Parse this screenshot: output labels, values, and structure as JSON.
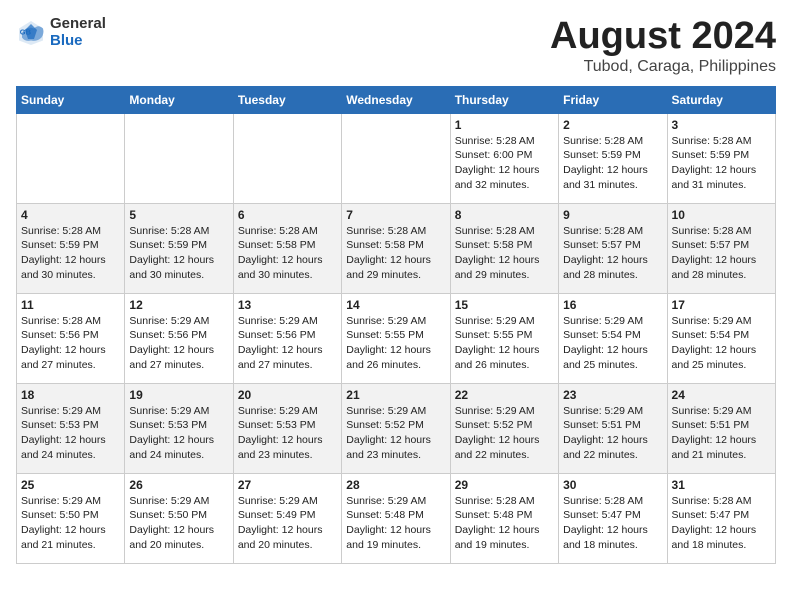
{
  "header": {
    "logo_general": "General",
    "logo_blue": "Blue",
    "title": "August 2024",
    "subtitle": "Tubod, Caraga, Philippines"
  },
  "weekdays": [
    "Sunday",
    "Monday",
    "Tuesday",
    "Wednesday",
    "Thursday",
    "Friday",
    "Saturday"
  ],
  "weeks": [
    [
      {
        "day": "",
        "info": ""
      },
      {
        "day": "",
        "info": ""
      },
      {
        "day": "",
        "info": ""
      },
      {
        "day": "",
        "info": ""
      },
      {
        "day": "1",
        "info": "Sunrise: 5:28 AM\nSunset: 6:00 PM\nDaylight: 12 hours\nand 32 minutes."
      },
      {
        "day": "2",
        "info": "Sunrise: 5:28 AM\nSunset: 5:59 PM\nDaylight: 12 hours\nand 31 minutes."
      },
      {
        "day": "3",
        "info": "Sunrise: 5:28 AM\nSunset: 5:59 PM\nDaylight: 12 hours\nand 31 minutes."
      }
    ],
    [
      {
        "day": "4",
        "info": "Sunrise: 5:28 AM\nSunset: 5:59 PM\nDaylight: 12 hours\nand 30 minutes."
      },
      {
        "day": "5",
        "info": "Sunrise: 5:28 AM\nSunset: 5:59 PM\nDaylight: 12 hours\nand 30 minutes."
      },
      {
        "day": "6",
        "info": "Sunrise: 5:28 AM\nSunset: 5:58 PM\nDaylight: 12 hours\nand 30 minutes."
      },
      {
        "day": "7",
        "info": "Sunrise: 5:28 AM\nSunset: 5:58 PM\nDaylight: 12 hours\nand 29 minutes."
      },
      {
        "day": "8",
        "info": "Sunrise: 5:28 AM\nSunset: 5:58 PM\nDaylight: 12 hours\nand 29 minutes."
      },
      {
        "day": "9",
        "info": "Sunrise: 5:28 AM\nSunset: 5:57 PM\nDaylight: 12 hours\nand 28 minutes."
      },
      {
        "day": "10",
        "info": "Sunrise: 5:28 AM\nSunset: 5:57 PM\nDaylight: 12 hours\nand 28 minutes."
      }
    ],
    [
      {
        "day": "11",
        "info": "Sunrise: 5:28 AM\nSunset: 5:56 PM\nDaylight: 12 hours\nand 27 minutes."
      },
      {
        "day": "12",
        "info": "Sunrise: 5:29 AM\nSunset: 5:56 PM\nDaylight: 12 hours\nand 27 minutes."
      },
      {
        "day": "13",
        "info": "Sunrise: 5:29 AM\nSunset: 5:56 PM\nDaylight: 12 hours\nand 27 minutes."
      },
      {
        "day": "14",
        "info": "Sunrise: 5:29 AM\nSunset: 5:55 PM\nDaylight: 12 hours\nand 26 minutes."
      },
      {
        "day": "15",
        "info": "Sunrise: 5:29 AM\nSunset: 5:55 PM\nDaylight: 12 hours\nand 26 minutes."
      },
      {
        "day": "16",
        "info": "Sunrise: 5:29 AM\nSunset: 5:54 PM\nDaylight: 12 hours\nand 25 minutes."
      },
      {
        "day": "17",
        "info": "Sunrise: 5:29 AM\nSunset: 5:54 PM\nDaylight: 12 hours\nand 25 minutes."
      }
    ],
    [
      {
        "day": "18",
        "info": "Sunrise: 5:29 AM\nSunset: 5:53 PM\nDaylight: 12 hours\nand 24 minutes."
      },
      {
        "day": "19",
        "info": "Sunrise: 5:29 AM\nSunset: 5:53 PM\nDaylight: 12 hours\nand 24 minutes."
      },
      {
        "day": "20",
        "info": "Sunrise: 5:29 AM\nSunset: 5:53 PM\nDaylight: 12 hours\nand 23 minutes."
      },
      {
        "day": "21",
        "info": "Sunrise: 5:29 AM\nSunset: 5:52 PM\nDaylight: 12 hours\nand 23 minutes."
      },
      {
        "day": "22",
        "info": "Sunrise: 5:29 AM\nSunset: 5:52 PM\nDaylight: 12 hours\nand 22 minutes."
      },
      {
        "day": "23",
        "info": "Sunrise: 5:29 AM\nSunset: 5:51 PM\nDaylight: 12 hours\nand 22 minutes."
      },
      {
        "day": "24",
        "info": "Sunrise: 5:29 AM\nSunset: 5:51 PM\nDaylight: 12 hours\nand 21 minutes."
      }
    ],
    [
      {
        "day": "25",
        "info": "Sunrise: 5:29 AM\nSunset: 5:50 PM\nDaylight: 12 hours\nand 21 minutes."
      },
      {
        "day": "26",
        "info": "Sunrise: 5:29 AM\nSunset: 5:50 PM\nDaylight: 12 hours\nand 20 minutes."
      },
      {
        "day": "27",
        "info": "Sunrise: 5:29 AM\nSunset: 5:49 PM\nDaylight: 12 hours\nand 20 minutes."
      },
      {
        "day": "28",
        "info": "Sunrise: 5:29 AM\nSunset: 5:48 PM\nDaylight: 12 hours\nand 19 minutes."
      },
      {
        "day": "29",
        "info": "Sunrise: 5:28 AM\nSunset: 5:48 PM\nDaylight: 12 hours\nand 19 minutes."
      },
      {
        "day": "30",
        "info": "Sunrise: 5:28 AM\nSunset: 5:47 PM\nDaylight: 12 hours\nand 18 minutes."
      },
      {
        "day": "31",
        "info": "Sunrise: 5:28 AM\nSunset: 5:47 PM\nDaylight: 12 hours\nand 18 minutes."
      }
    ]
  ]
}
